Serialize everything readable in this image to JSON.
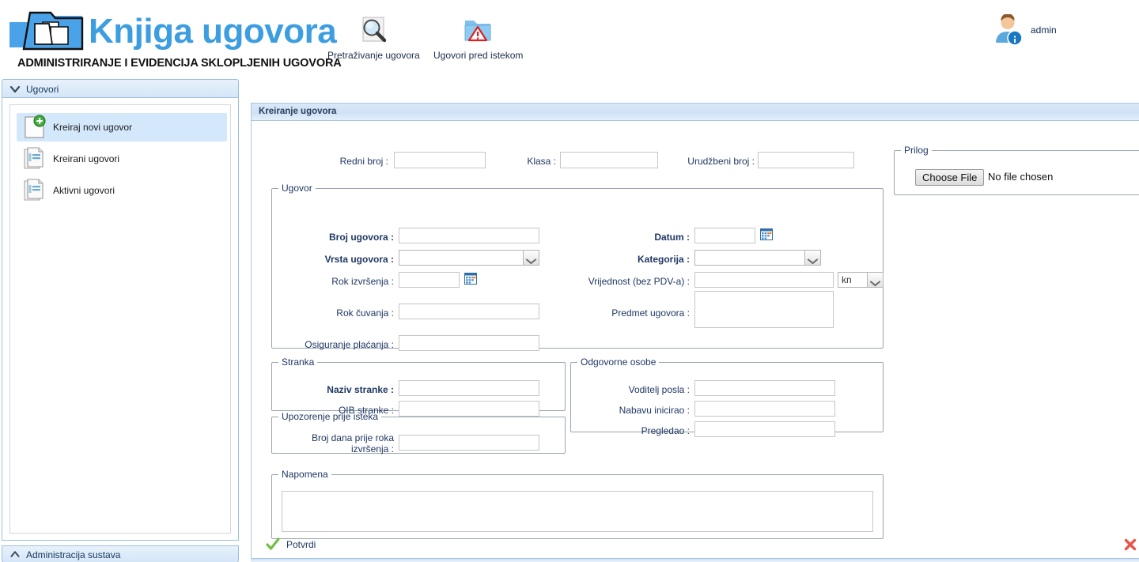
{
  "app": {
    "logo_title": "Knjiga ugovora",
    "logo_subtitle": "ADMINISTRIRANJE I EVIDENCIJA SKLOPLJENIH UGOVORA",
    "logo_icon": "folder-documents-icon"
  },
  "toolbar": {
    "items": [
      {
        "label": "Pretraživanje ugovora",
        "icon": "magnifier-search-icon"
      },
      {
        "label": "Ugovori pred istekom",
        "icon": "folder-warning-icon"
      }
    ]
  },
  "user": {
    "name": "admin",
    "icon": "user-info-avatar-icon"
  },
  "sidebar": {
    "header": {
      "label": "Ugovori",
      "icon": "chevron-down-icon"
    },
    "items": [
      {
        "label": "Kreiraj novi ugovor",
        "icon": "document-add-icon",
        "active": true
      },
      {
        "label": "Kreirani ugovori",
        "icon": "documents-stack-icon",
        "active": false
      },
      {
        "label": "Aktivni ugovori",
        "icon": "documents-stack-icon",
        "active": false
      }
    ],
    "footer": {
      "label": "Administracija sustava",
      "icon": "chevron-up-icon"
    }
  },
  "panel": {
    "title": "Kreiranje ugovora",
    "top_fields": [
      {
        "label": "Redni broj :",
        "value": "",
        "name": "redni-broj"
      },
      {
        "label": "Klasa :",
        "value": "",
        "name": "klasa"
      },
      {
        "label": "Urudžbeni broj :",
        "value": "",
        "name": "urudzbeni-broj"
      }
    ],
    "prilog": {
      "legend": "Prilog",
      "choose_button": "Choose File",
      "file_status": "No file chosen"
    },
    "ugovor": {
      "legend": "Ugovor",
      "broj_ugovora_label": "Broj ugovora :",
      "broj_ugovora_value": "",
      "vrsta_ugovora_label": "Vrsta ugovora :",
      "vrsta_ugovora_value": "",
      "rok_izvrsenja_label": "Rok izvršenja :",
      "rok_izvrsenja_value": "",
      "rok_cuvanja_label": "Rok čuvanja :",
      "rok_cuvanja_value": "",
      "osiguranje_placanja_label": "Osiguranje plaćanja :",
      "osiguranje_placanja_value": "",
      "datum_label": "Datum :",
      "datum_value": "",
      "kategorija_label": "Kategorija :",
      "kategorija_value": "",
      "vrijednost_label": "Vrijednost (bez PDV-a) :",
      "vrijednost_value": "",
      "valuta_value": "kn",
      "predmet_label": "Predmet ugovora :",
      "predmet_value": ""
    },
    "stranka": {
      "legend": "Stranka",
      "naziv_label": "Naziv stranke :",
      "naziv_value": "",
      "oib_label": "OIB stranke :",
      "oib_value": ""
    },
    "upozorenje": {
      "legend": "Upozorenje prije isteka",
      "dana_label_line1": "Broj dana prije roka",
      "dana_label_line2": "izvršenja :",
      "dana_value": ""
    },
    "odgovorne": {
      "legend": "Odgovorne osobe",
      "voditelj_label": "Voditelj posla :",
      "voditelj_value": "",
      "nabavu_label": "Nabavu inicirao :",
      "nabavu_value": "",
      "pregledao_label": "Pregledao :",
      "pregledao_value": ""
    },
    "napomena": {
      "legend": "Napomena",
      "value": ""
    },
    "confirm_label": "Potvrdi",
    "confirm_icon": "green-check-icon",
    "close_icon": "red-x-icon"
  },
  "colors": {
    "brand_blue": "#3c9ee0",
    "label_navy": "#1f3864",
    "panel_header": "#cfe1f5",
    "sidebar_active": "#d4e8fb",
    "confirm_green": "#76c043",
    "close_red": "#e8544a"
  }
}
